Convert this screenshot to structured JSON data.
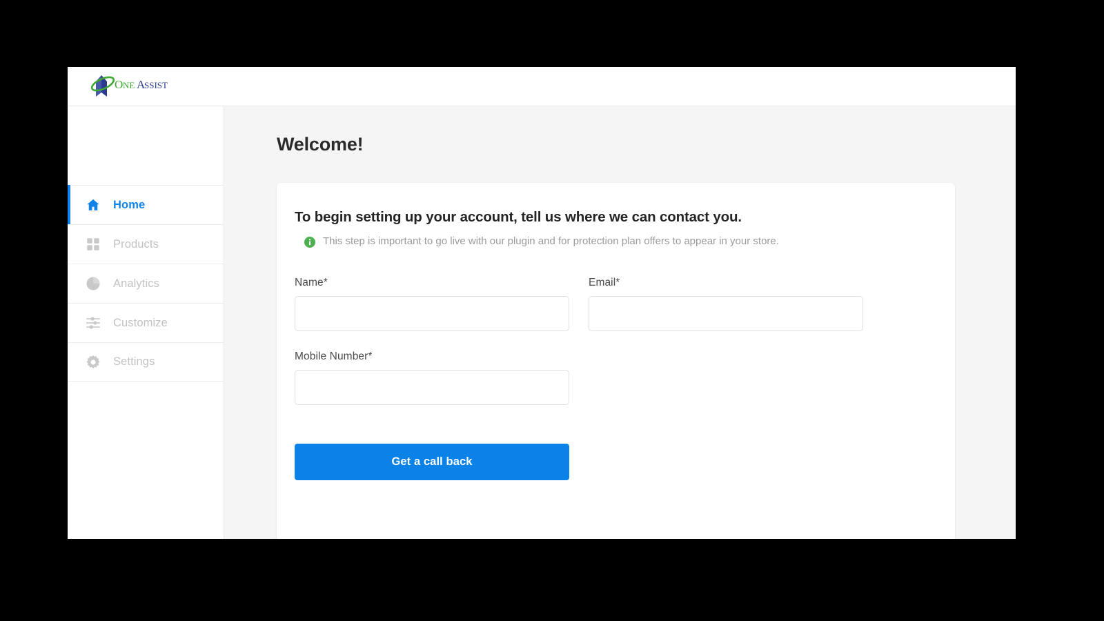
{
  "brand": {
    "logo_icon": "oneassist-swoosh-logo",
    "name_part_one": "One",
    "name_part_two": "Assist"
  },
  "sidebar": {
    "items": [
      {
        "id": "home",
        "label": "Home",
        "icon": "home-icon",
        "active": true
      },
      {
        "id": "products",
        "label": "Products",
        "icon": "grid-icon",
        "active": false
      },
      {
        "id": "analytics",
        "label": "Analytics",
        "icon": "pie-chart-icon",
        "active": false
      },
      {
        "id": "customize",
        "label": "Customize",
        "icon": "sliders-icon",
        "active": false
      },
      {
        "id": "settings",
        "label": "Settings",
        "icon": "gear-icon",
        "active": false
      }
    ]
  },
  "main": {
    "page_title": "Welcome!",
    "card": {
      "heading": "To begin setting up your account, tell us where we can contact you.",
      "note_icon": "info-circle-icon",
      "note": "This step is important to go live with our plugin and for protection plan offers to appear in your store.",
      "fields": {
        "name": {
          "label": "Name*",
          "value": "",
          "placeholder": ""
        },
        "email": {
          "label": "Email*",
          "value": "",
          "placeholder": ""
        },
        "mobile": {
          "label": "Mobile Number*",
          "value": "",
          "placeholder": ""
        }
      },
      "submit_label": "Get a call back"
    }
  },
  "colors": {
    "accent_blue": "#0b82e8",
    "active_nav_blue": "#1183e8",
    "info_green": "#4caf50",
    "logo_green": "#3ea832",
    "logo_blue": "#2c3b8f",
    "content_bg": "#f5f5f5",
    "muted_text": "#c2c2c2"
  }
}
